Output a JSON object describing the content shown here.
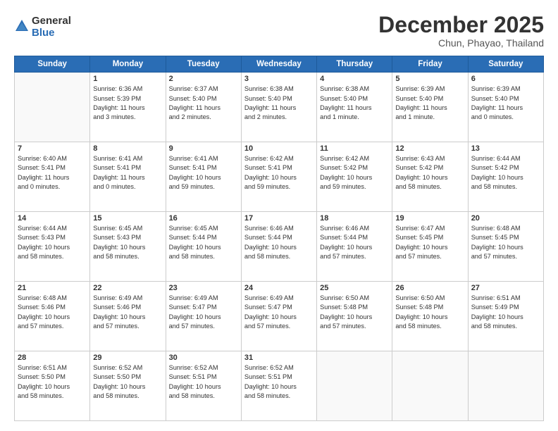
{
  "logo": {
    "general": "General",
    "blue": "Blue"
  },
  "header": {
    "month": "December 2025",
    "location": "Chun, Phayao, Thailand"
  },
  "weekdays": [
    "Sunday",
    "Monday",
    "Tuesday",
    "Wednesday",
    "Thursday",
    "Friday",
    "Saturday"
  ],
  "weeks": [
    [
      {
        "day": "",
        "info": ""
      },
      {
        "day": "1",
        "info": "Sunrise: 6:36 AM\nSunset: 5:39 PM\nDaylight: 11 hours\nand 3 minutes."
      },
      {
        "day": "2",
        "info": "Sunrise: 6:37 AM\nSunset: 5:40 PM\nDaylight: 11 hours\nand 2 minutes."
      },
      {
        "day": "3",
        "info": "Sunrise: 6:38 AM\nSunset: 5:40 PM\nDaylight: 11 hours\nand 2 minutes."
      },
      {
        "day": "4",
        "info": "Sunrise: 6:38 AM\nSunset: 5:40 PM\nDaylight: 11 hours\nand 1 minute."
      },
      {
        "day": "5",
        "info": "Sunrise: 6:39 AM\nSunset: 5:40 PM\nDaylight: 11 hours\nand 1 minute."
      },
      {
        "day": "6",
        "info": "Sunrise: 6:39 AM\nSunset: 5:40 PM\nDaylight: 11 hours\nand 0 minutes."
      }
    ],
    [
      {
        "day": "7",
        "info": "Sunrise: 6:40 AM\nSunset: 5:41 PM\nDaylight: 11 hours\nand 0 minutes."
      },
      {
        "day": "8",
        "info": "Sunrise: 6:41 AM\nSunset: 5:41 PM\nDaylight: 11 hours\nand 0 minutes."
      },
      {
        "day": "9",
        "info": "Sunrise: 6:41 AM\nSunset: 5:41 PM\nDaylight: 10 hours\nand 59 minutes."
      },
      {
        "day": "10",
        "info": "Sunrise: 6:42 AM\nSunset: 5:41 PM\nDaylight: 10 hours\nand 59 minutes."
      },
      {
        "day": "11",
        "info": "Sunrise: 6:42 AM\nSunset: 5:42 PM\nDaylight: 10 hours\nand 59 minutes."
      },
      {
        "day": "12",
        "info": "Sunrise: 6:43 AM\nSunset: 5:42 PM\nDaylight: 10 hours\nand 58 minutes."
      },
      {
        "day": "13",
        "info": "Sunrise: 6:44 AM\nSunset: 5:42 PM\nDaylight: 10 hours\nand 58 minutes."
      }
    ],
    [
      {
        "day": "14",
        "info": "Sunrise: 6:44 AM\nSunset: 5:43 PM\nDaylight: 10 hours\nand 58 minutes."
      },
      {
        "day": "15",
        "info": "Sunrise: 6:45 AM\nSunset: 5:43 PM\nDaylight: 10 hours\nand 58 minutes."
      },
      {
        "day": "16",
        "info": "Sunrise: 6:45 AM\nSunset: 5:44 PM\nDaylight: 10 hours\nand 58 minutes."
      },
      {
        "day": "17",
        "info": "Sunrise: 6:46 AM\nSunset: 5:44 PM\nDaylight: 10 hours\nand 58 minutes."
      },
      {
        "day": "18",
        "info": "Sunrise: 6:46 AM\nSunset: 5:44 PM\nDaylight: 10 hours\nand 57 minutes."
      },
      {
        "day": "19",
        "info": "Sunrise: 6:47 AM\nSunset: 5:45 PM\nDaylight: 10 hours\nand 57 minutes."
      },
      {
        "day": "20",
        "info": "Sunrise: 6:48 AM\nSunset: 5:45 PM\nDaylight: 10 hours\nand 57 minutes."
      }
    ],
    [
      {
        "day": "21",
        "info": "Sunrise: 6:48 AM\nSunset: 5:46 PM\nDaylight: 10 hours\nand 57 minutes."
      },
      {
        "day": "22",
        "info": "Sunrise: 6:49 AM\nSunset: 5:46 PM\nDaylight: 10 hours\nand 57 minutes."
      },
      {
        "day": "23",
        "info": "Sunrise: 6:49 AM\nSunset: 5:47 PM\nDaylight: 10 hours\nand 57 minutes."
      },
      {
        "day": "24",
        "info": "Sunrise: 6:49 AM\nSunset: 5:47 PM\nDaylight: 10 hours\nand 57 minutes."
      },
      {
        "day": "25",
        "info": "Sunrise: 6:50 AM\nSunset: 5:48 PM\nDaylight: 10 hours\nand 57 minutes."
      },
      {
        "day": "26",
        "info": "Sunrise: 6:50 AM\nSunset: 5:48 PM\nDaylight: 10 hours\nand 58 minutes."
      },
      {
        "day": "27",
        "info": "Sunrise: 6:51 AM\nSunset: 5:49 PM\nDaylight: 10 hours\nand 58 minutes."
      }
    ],
    [
      {
        "day": "28",
        "info": "Sunrise: 6:51 AM\nSunset: 5:50 PM\nDaylight: 10 hours\nand 58 minutes."
      },
      {
        "day": "29",
        "info": "Sunrise: 6:52 AM\nSunset: 5:50 PM\nDaylight: 10 hours\nand 58 minutes."
      },
      {
        "day": "30",
        "info": "Sunrise: 6:52 AM\nSunset: 5:51 PM\nDaylight: 10 hours\nand 58 minutes."
      },
      {
        "day": "31",
        "info": "Sunrise: 6:52 AM\nSunset: 5:51 PM\nDaylight: 10 hours\nand 58 minutes."
      },
      {
        "day": "",
        "info": ""
      },
      {
        "day": "",
        "info": ""
      },
      {
        "day": "",
        "info": ""
      }
    ]
  ]
}
